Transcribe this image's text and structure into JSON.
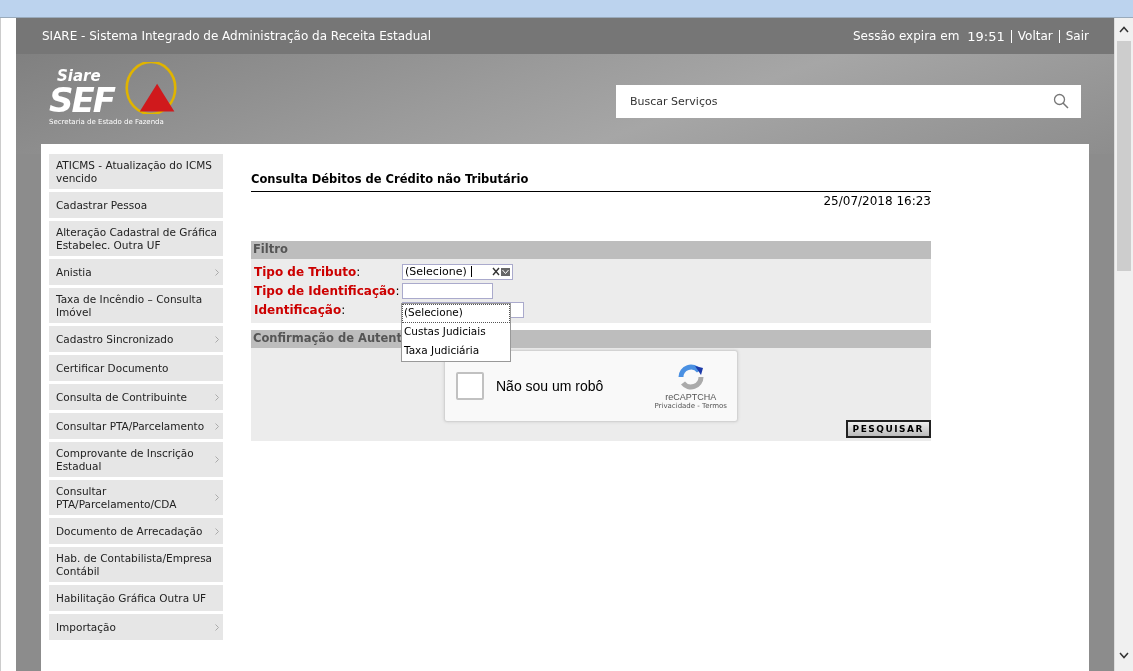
{
  "header": {
    "title": "SIARE - Sistema Integrado de Administração da Receita Estadual",
    "session_label": "Sessão expira em",
    "session_time": "19:51",
    "links": [
      "Voltar",
      "Sair"
    ]
  },
  "logo": {
    "top": "Siare",
    "main": "SEF",
    "caption": "Secretaria de Estado de Fazenda"
  },
  "search": {
    "placeholder": "Buscar Serviços"
  },
  "sidebar": {
    "items": [
      {
        "label": "ATICMS - Atualização do ICMS vencido",
        "has_submenu": false
      },
      {
        "label": "Cadastrar Pessoa",
        "has_submenu": false
      },
      {
        "label": "Alteração Cadastral de Gráfica Estabelec. Outra UF",
        "has_submenu": false
      },
      {
        "label": "Anistia",
        "has_submenu": true
      },
      {
        "label": "Taxa de Incêndio – Consulta Imóvel",
        "has_submenu": false
      },
      {
        "label": "Cadastro Sincronizado",
        "has_submenu": true
      },
      {
        "label": "Certificar Documento",
        "has_submenu": false
      },
      {
        "label": "Consulta de Contribuinte",
        "has_submenu": true
      },
      {
        "label": "Consultar PTA/Parcelamento",
        "has_submenu": true
      },
      {
        "label": "Comprovante de Inscrição Estadual",
        "has_submenu": true
      },
      {
        "label": "Consultar PTA/Parcelamento/CDA",
        "has_submenu": true
      },
      {
        "label": "Documento de Arrecadação",
        "has_submenu": true
      },
      {
        "label": "Hab. de Contabilista/Empresa Contábil",
        "has_submenu": false
      },
      {
        "label": "Habilitação Gráfica Outra UF",
        "has_submenu": false
      },
      {
        "label": "Importação",
        "has_submenu": true
      }
    ]
  },
  "page": {
    "title": "Consulta Débitos de Crédito não Tributário",
    "datetime": "25/07/2018 16:23"
  },
  "filter": {
    "heading": "Filtro",
    "fields": [
      {
        "label": "**Tipo de Tributo**:",
        "kind": "select",
        "value": "(Selecione)"
      },
      {
        "label": "**Tipo de Identificação**:",
        "kind": "select"
      },
      {
        "label": "**Identificação**:",
        "kind": "input"
      }
    ]
  },
  "dropdown": {
    "options": [
      {
        "label": "(Selecione)",
        "selected": true
      },
      {
        "label": "Custas Judiciais",
        "selected": false
      },
      {
        "label": "Taxa Judiciária",
        "selected": false
      }
    ]
  },
  "auth": {
    "heading": "Confirmação de Autent",
    "captcha": {
      "label": "Não sou um robô",
      "checked": false,
      "brand": "reCAPTCHA",
      "links": "Privacidade - Termos"
    }
  },
  "submit": "PESQUISAR"
}
